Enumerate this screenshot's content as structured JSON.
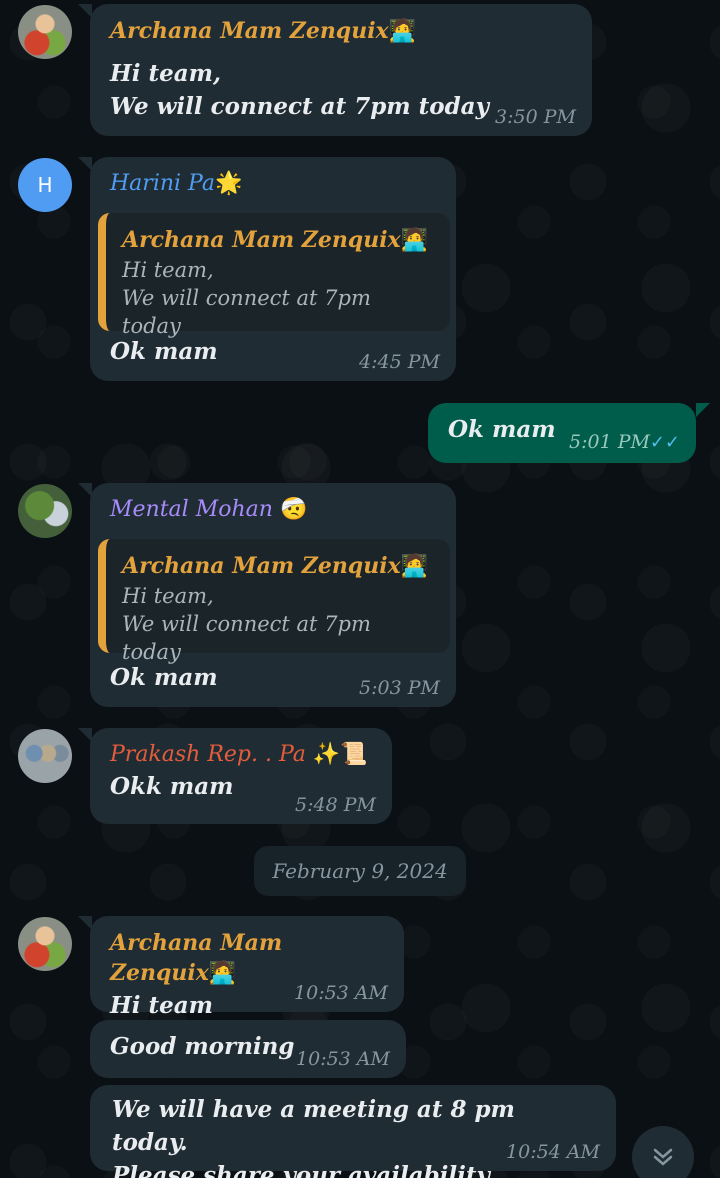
{
  "colors": {
    "background": "#0b1014",
    "incoming_bubble": "#202c33",
    "outgoing_bubble": "#005c4b",
    "archana_name": "#e3a23c",
    "harini_name": "#4f9cf2",
    "mohan_name": "#a78bfa",
    "prakash_name": "#e35d3c",
    "read_ticks": "#53bdeb"
  },
  "messages": [
    {
      "sender": "Archana Mam Zenquix",
      "sender_emoji": "🧑‍💻",
      "lines": [
        "Hi team,",
        "We will connect at 7pm today"
      ],
      "time": "3:50 PM"
    },
    {
      "avatar_letter": "H",
      "sender": "Harini Pa",
      "sender_emoji": "🌟",
      "quote": {
        "name": "Archana Mam Zenquix",
        "emoji": "🧑‍💻",
        "lines": [
          "Hi team,",
          "We will connect at 7pm today"
        ]
      },
      "text": "Ok mam",
      "time": "4:45 PM"
    },
    {
      "direction": "outgoing",
      "text": "Ok mam",
      "time": "5:01 PM",
      "ticks_icon": "double-check-icon"
    },
    {
      "sender": "Mental Mohan",
      "sender_emoji": "🤕",
      "quote": {
        "name": "Archana Mam Zenquix",
        "emoji": "🧑‍💻",
        "lines": [
          "Hi team,",
          "We will connect at 7pm today"
        ]
      },
      "text": "Ok mam",
      "time": "5:03 PM"
    },
    {
      "sender": "Prakash Rep. .  Pa",
      "sender_emoji": "✨📜",
      "text": "Okk mam",
      "time": "5:48 PM"
    },
    {
      "sender": "Archana Mam Zenquix",
      "sender_emoji": "🧑‍💻",
      "text": "Hi team",
      "time": "10:53 AM"
    },
    {
      "text": "Good morning",
      "time": "10:53 AM"
    },
    {
      "lines": [
        "We will have a meeting at 8 pm today.",
        "Please share your availability."
      ],
      "time": "10:54 AM"
    }
  ],
  "date_separator": "February 9, 2024",
  "scroll_button_icon": "chevron-double-down-icon"
}
